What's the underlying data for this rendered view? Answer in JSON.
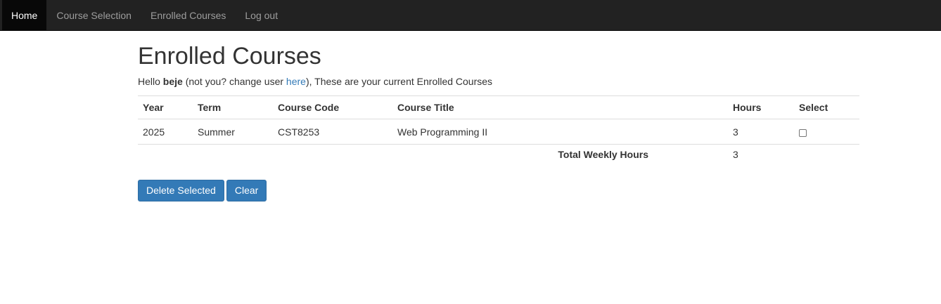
{
  "nav": {
    "items": [
      {
        "label": "Home",
        "active": true
      },
      {
        "label": "Course Selection",
        "active": false
      },
      {
        "label": "Enrolled Courses",
        "active": false
      },
      {
        "label": "Log out",
        "active": false
      }
    ]
  },
  "page": {
    "title": "Enrolled Courses",
    "greeting": {
      "prefix": "Hello ",
      "username": "beje",
      "middle": " (not you? change user ",
      "link_text": "here",
      "suffix": "), These are your current Enrolled Courses"
    }
  },
  "table": {
    "headers": [
      "Year",
      "Term",
      "Course Code",
      "Course Title",
      "Hours",
      "Select"
    ],
    "rows": [
      {
        "year": "2025",
        "term": "Summer",
        "code": "CST8253",
        "title": "Web Programming II",
        "hours": "3",
        "selected": false
      }
    ],
    "total_label": "Total Weekly Hours",
    "total_hours": "3"
  },
  "buttons": {
    "delete_label": "Delete Selected",
    "clear_label": "Clear"
  },
  "colors": {
    "navbar_bg": "#222222",
    "nav_active_bg": "#080808",
    "link": "#337ab7",
    "button_bg": "#337ab7"
  }
}
